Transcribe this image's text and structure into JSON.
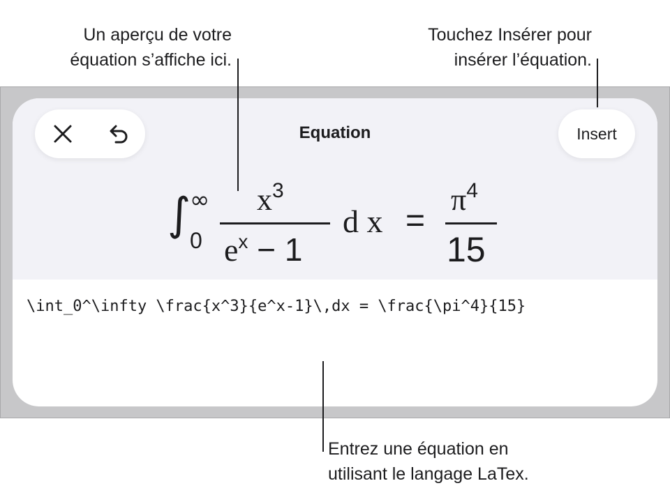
{
  "callouts": {
    "preview": [
      "Un aperçu de votre",
      "équation s’affiche ici."
    ],
    "insert": [
      "Touchez Insérer pour",
      "insérer l’équation."
    ],
    "latex": [
      "Entrez une équation en",
      "utilisant le langage LaTex."
    ]
  },
  "sheet": {
    "title": "Equation",
    "insert_label": "Insert",
    "close_icon": "close-icon",
    "undo_icon": "undo-icon"
  },
  "equation": {
    "integral": "∫",
    "upper_limit": "∞",
    "lower_limit": "0",
    "num1_base": "x",
    "num1_exp": "3",
    "den1_base": "e",
    "den1_exp": "x",
    "den1_rest": " − 1",
    "differential": "d x",
    "equals": "=",
    "num2_base": "π",
    "num2_exp": "4",
    "den2": "15"
  },
  "latex_source": "\\int_0^\\infty \\frac{x^3}{e^x-1}\\,dx = \\frac{\\pi^4}{15}",
  "colors": {
    "backdrop": "#c7c7c9",
    "sheet_top": "#f2f2f7",
    "text": "#1c1c1e"
  }
}
